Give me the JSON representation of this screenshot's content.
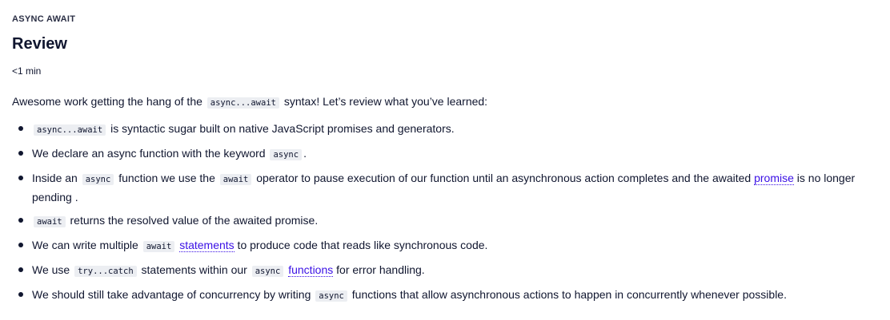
{
  "header": {
    "eyebrow": "ASYNC AWAIT",
    "title": "Review",
    "duration": "<1 min"
  },
  "intro": {
    "before": "Awesome work getting the hang of the ",
    "code": "async...await",
    "after": " syntax! Let’s review what you’ve learned:"
  },
  "items": [
    {
      "code_a": "async...await",
      "text_a": " is syntactic sugar built on native JavaScript promises and generators."
    },
    {
      "text_a": "We declare an async function with the keyword ",
      "code_a": "async",
      "text_b": "."
    },
    {
      "text_a": "Inside an ",
      "code_a": "async",
      "text_b": " function we use the ",
      "code_b": "await",
      "text_c": " operator to pause execution of our function until an asynchronous action completes and the awaited ",
      "link": "promise",
      "text_d": " is no longer pending ."
    },
    {
      "code_a": "await",
      "text_a": " returns the resolved value of the awaited promise."
    },
    {
      "text_a": "We can write multiple ",
      "code_a": "await",
      "link": "statements",
      "text_b": " to produce code that reads like synchronous code."
    },
    {
      "text_a": "We use ",
      "code_a": "try...catch",
      "text_b": " statements within our ",
      "code_b": "async",
      "link": "functions",
      "text_c": " for error handling."
    },
    {
      "text_a": "We should still take advantage of concurrency by writing ",
      "code_a": "async",
      "text_b": " functions that allow asynchronous actions to happen in concurrently whenever possible."
    }
  ],
  "colors": {
    "text": "#10162f",
    "link": "#3a10e5",
    "code_bg": "#eceef2"
  }
}
